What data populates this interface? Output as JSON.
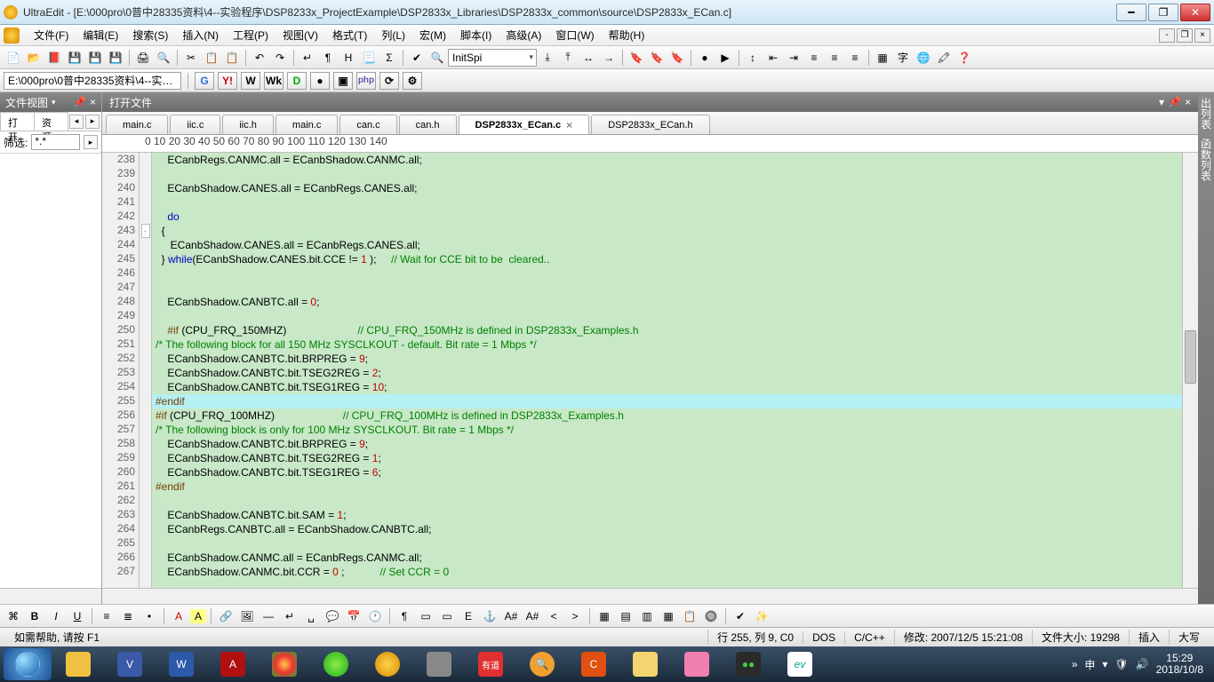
{
  "title": "UltraEdit - [E:\\000pro\\0普中28335资料\\4--实验程序\\DSP8233x_ProjectExample\\DSP2833x_Libraries\\DSP2833x_common\\source\\DSP2833x_ECan.c]",
  "menu": {
    "file": "文件(F)",
    "edit": "编辑(E)",
    "search": "搜索(S)",
    "insert": "插入(N)",
    "project": "工程(P)",
    "view": "视图(V)",
    "format": "格式(T)",
    "column": "列(L)",
    "macro": "宏(M)",
    "script": "脚本(I)",
    "advanced": "高级(A)",
    "window": "窗口(W)",
    "help": "帮助(H)"
  },
  "toolbar": {
    "combo": "InitSpi"
  },
  "pathbar": {
    "path": "E:\\000pro\\0普中28335资料\\4--实…"
  },
  "sidepanel": {
    "title": "文件视图",
    "tab_open": "打开",
    "tab_res": "资源",
    "filter_label": "筛选:",
    "filter_value": "*.*"
  },
  "openfiles": {
    "title": "打开文件"
  },
  "tabs": [
    "main.c",
    "iic.c",
    "iic.h",
    "main.c",
    "can.c",
    "can.h",
    "DSP2833x_ECan.c",
    "DSP2833x_ECan.h"
  ],
  "active_tab": 6,
  "ruler": "    0          10         20         30         40         50         60         70         80         90         100        110        120        130        140",
  "ruler_marks": "┬──┴──┬─┴──┬──┴──┬──┴──┬──┴──┬──┴──┬──┴──┬──┴──┬──┴──┬──┴──┬──┴──┬──┴──┬──┴──┬──┴──┬──┴──",
  "first_line_no": 238,
  "rightstrip": {
    "a": "出列表",
    "b": "函数列表"
  },
  "status": {
    "help": "如需帮助, 请按 F1",
    "pos": "行 255, 列 9, C0",
    "enc": "DOS",
    "lang": "C/C++",
    "mod": "修改: 2007/12/5 15:21:08",
    "size": "文件大小: 19298",
    "ins": "插入",
    "caps": "大写"
  },
  "taskbar": {
    "chev": "»",
    "lang": "申",
    "time": "15:29",
    "date": "2018/10/8"
  },
  "btns": {
    "G": "G",
    "Y": "Y!",
    "W": "W",
    "Wk": "Wk",
    "D": "D",
    "php": "php",
    "yd": "有道"
  }
}
